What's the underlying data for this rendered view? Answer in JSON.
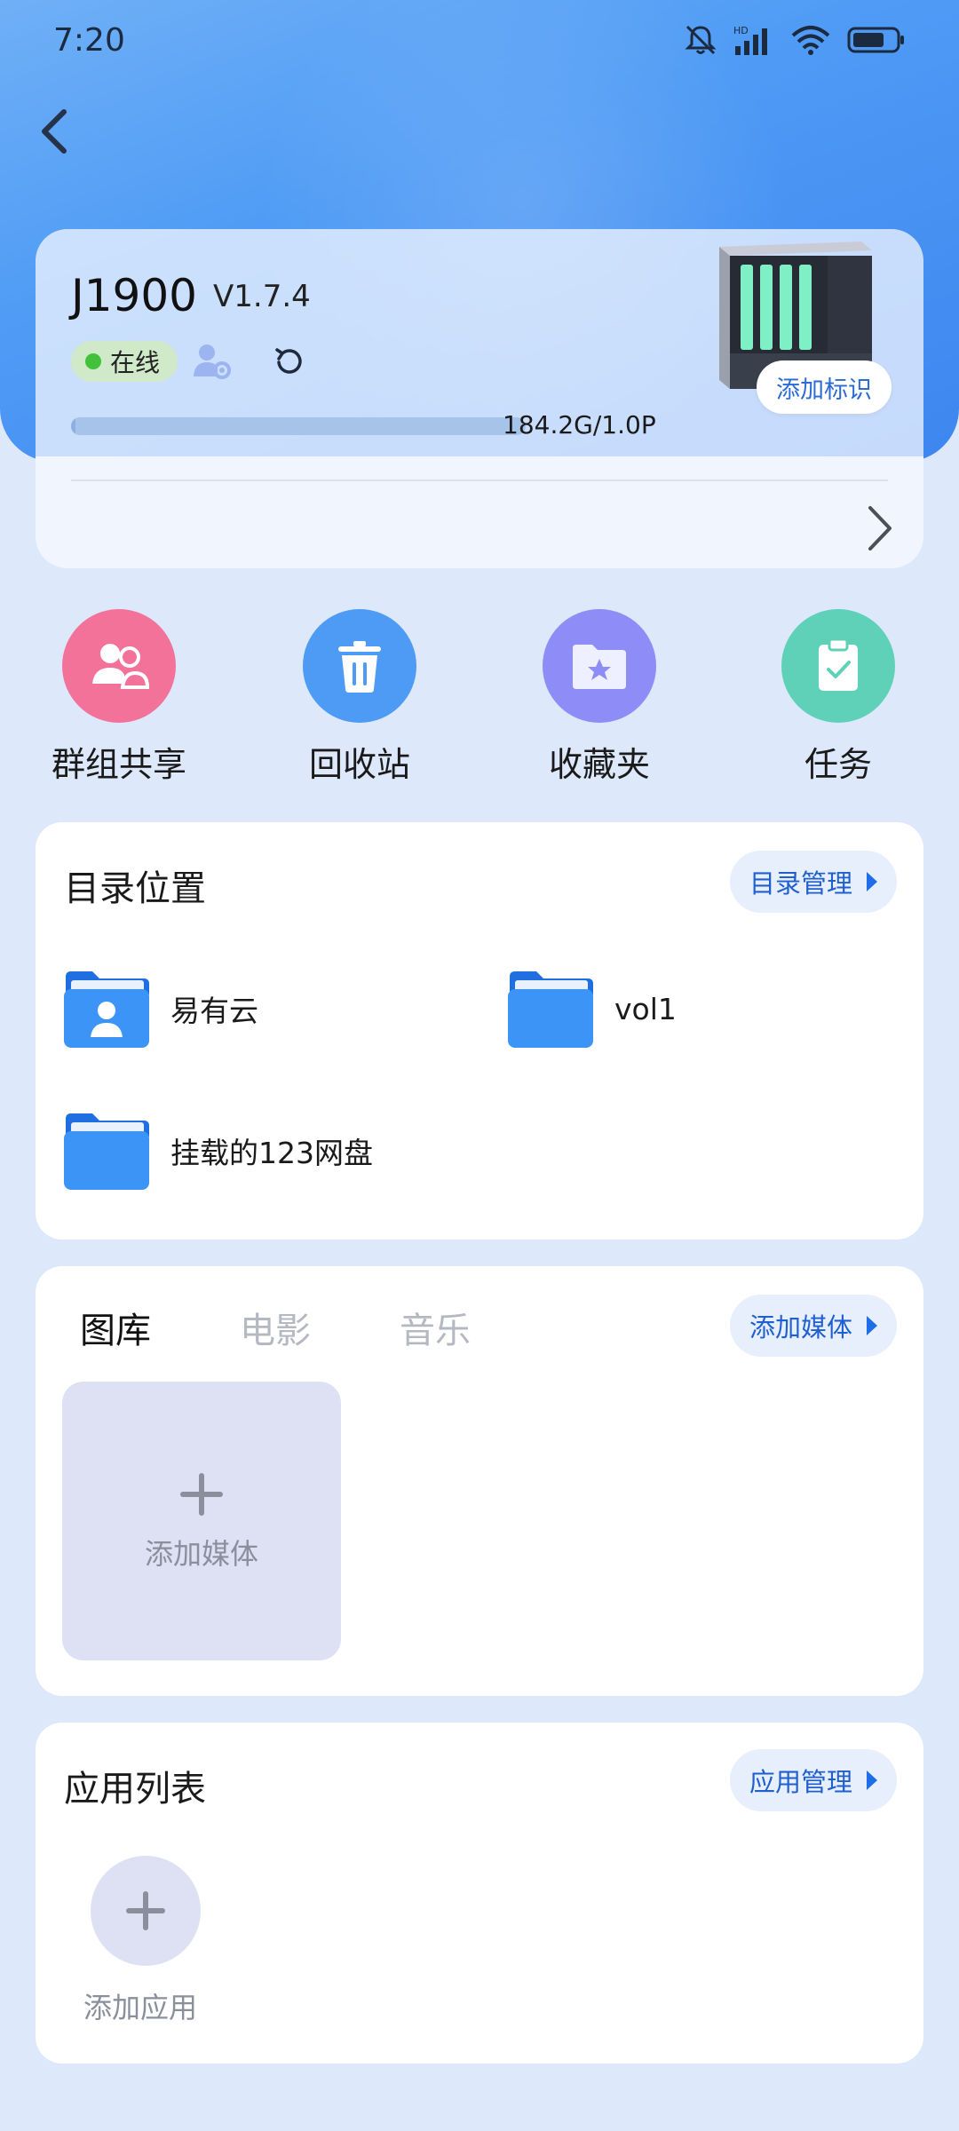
{
  "status": {
    "time": "7:20"
  },
  "device": {
    "name": "J1900",
    "version": "V1.7.4",
    "status": "在线",
    "storage": "184.2G/1.0P",
    "storage_used_fraction": 0.0002,
    "tag_button": "添加标识"
  },
  "quick": [
    {
      "label": "群组共享",
      "color": "#f3729a",
      "icon": "group-share-icon"
    },
    {
      "label": "回收站",
      "color": "#4e9bf5",
      "icon": "trash-icon"
    },
    {
      "label": "收藏夹",
      "color": "#8e8cf6",
      "icon": "favorites-folder-icon"
    },
    {
      "label": "任务",
      "color": "#5fd1b9",
      "icon": "task-clipboard-icon"
    }
  ],
  "directories": {
    "title": "目录位置",
    "manage": "目录管理",
    "items": [
      "易有云",
      "vol1",
      "挂载的123网盘"
    ]
  },
  "media": {
    "tabs": [
      "图库",
      "电影",
      "音乐"
    ],
    "add_button": "添加媒体",
    "add_tile": "添加媒体"
  },
  "apps": {
    "title": "应用列表",
    "manage": "应用管理",
    "add_label": "添加应用"
  }
}
